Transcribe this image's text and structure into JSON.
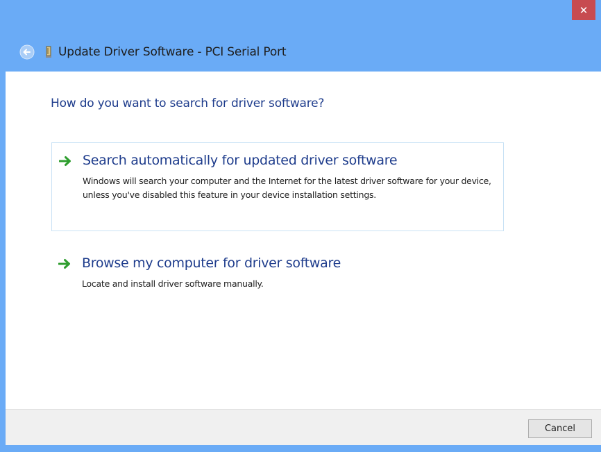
{
  "window": {
    "title": "Update Driver Software - PCI Serial Port",
    "close_label": "✕"
  },
  "main": {
    "question": "How do you want to search for driver software?",
    "options": [
      {
        "title": "Search automatically for updated driver software",
        "description": "Windows will search your computer and the Internet for the latest driver software for your device, unless you've disabled this feature in your device installation settings."
      },
      {
        "title": "Browse my computer for driver software",
        "description": "Locate and install driver software manually."
      }
    ]
  },
  "footer": {
    "cancel_label": "Cancel"
  },
  "icons": {
    "back": "back-arrow-icon",
    "device": "device-icon",
    "option_arrow": "green-arrow-icon",
    "close": "close-icon"
  },
  "colors": {
    "title_bar": "#6aabf6",
    "close_button": "#c74b50",
    "heading_text": "#1e3c8c",
    "arrow_green": "#2f9e2f",
    "option_border": "#c9e2f5"
  }
}
